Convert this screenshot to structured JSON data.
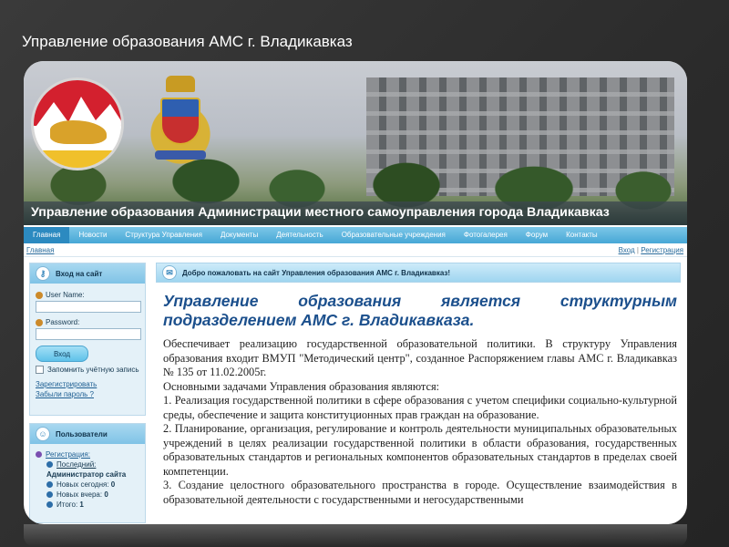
{
  "slide": {
    "title": "Управление образования АМС г. Владикавказ"
  },
  "site": {
    "header": "Управление образования Администрации местного самоуправления города Владикавказ"
  },
  "nav": [
    {
      "label": "Главная",
      "active": true
    },
    {
      "label": "Новости"
    },
    {
      "label": "Структура Управления"
    },
    {
      "label": "Документы"
    },
    {
      "label": "Деятельность"
    },
    {
      "label": "Образовательные учреждения"
    },
    {
      "label": "Фотогалерея"
    },
    {
      "label": "Форум"
    },
    {
      "label": "Контакты"
    }
  ],
  "breadcrumb": {
    "home": "Главная",
    "login": "Вход",
    "separator": "|",
    "register": "Регистрация"
  },
  "login": {
    "title": "Вход на сайт",
    "username_label": "User Name:",
    "password_label": "Password:",
    "button": "Вход",
    "remember": "Запомнить учётную запись",
    "register_link": "Зарегистрировать",
    "forgot_link": "Забыли пароль ?"
  },
  "users": {
    "title": "Пользователи",
    "registration": "Регистрация:",
    "last": "Последний:",
    "last_name": "Администратор сайта",
    "new_today_label": "Новых сегодня:",
    "new_today": "0",
    "new_yesterday_label": "Новых вчера:",
    "new_yesterday": "0",
    "total_label": "Итого:",
    "total": "1"
  },
  "main": {
    "welcome": "Добро пожаловать на сайт Управления образования АМС г. Владикавказ!",
    "heading": "Управление образования является структурным подразделением АМС г. Владикавказа.",
    "paragraphs": [
      "Обеспечивает реализацию государственной образовательной политики. В структуру Управления образования входит ВМУП \"Методический центр\", созданное Распоряжением главы АМС г. Владикавказ № 135 от 11.02.2005г.",
      "Основными задачами Управления образования являются:",
      "1. Реализация государственной политики в сфере образования с учетом специфики социально-культурной среды, обеспечение и защита конституционных прав граждан на образование.",
      "2. Планирование, организация, регулирование и контроль деятельности муниципальных образовательных учреждений в целях реализации государственной политики в области образования, государственных образовательных стандартов и региональных компонентов образовательных стандартов в пределах своей компетенции.",
      "3. Создание целостного образовательного пространства в городе. Осуществление взаимодействия в образовательной деятельности с государственными и негосударственными"
    ]
  },
  "colors": {
    "nav": "#47a7d6",
    "heading": "#1b4f8c",
    "panel": "#e4f1f8"
  },
  "icons": {
    "login": "key-icon",
    "users": "users-icon"
  }
}
